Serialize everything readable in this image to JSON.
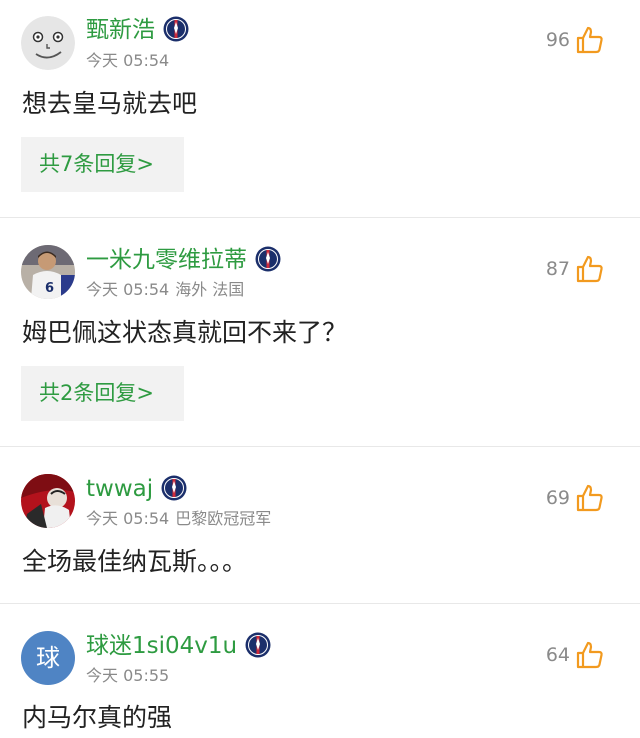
{
  "comments": [
    {
      "username": "甄新浩",
      "time": "今天 05:54",
      "location": "",
      "team": "",
      "likes": "96",
      "text": "想去皇马就去吧",
      "replies_label": "共7条回复>",
      "avatar": "smiley-face"
    },
    {
      "username": "一米九零维拉蒂",
      "time": "今天 05:54",
      "location": "海外 法国",
      "team": "",
      "likes": "87",
      "text": "姆巴佩这状态真就回不来了？",
      "replies_label": "共2条回复>",
      "avatar": "player-photo"
    },
    {
      "username": "twwaj",
      "time": "今天 05:54",
      "location": "",
      "team": "巴黎欧冠冠军",
      "likes": "69",
      "text": "全场最佳纳瓦斯。。。",
      "replies_label": "",
      "avatar": "red-photo"
    },
    {
      "username": "球迷1si04v1u",
      "time": "今天 05:55",
      "location": "",
      "team": "",
      "likes": "64",
      "text": "内马尔真的强",
      "replies_label": "",
      "avatar": "letter",
      "avatar_letter": "球"
    }
  ],
  "colors": {
    "username_green": "#2e9b41",
    "meta_gray": "#8a8a8a",
    "like_orange": "#f29a1f",
    "psg_blue": "#1b2f6b",
    "psg_red": "#d12b3b",
    "letter_avatar_bg": "#4f84c4"
  },
  "icons": {
    "like": "thumbs-up-icon",
    "team": "psg-badge-icon"
  }
}
